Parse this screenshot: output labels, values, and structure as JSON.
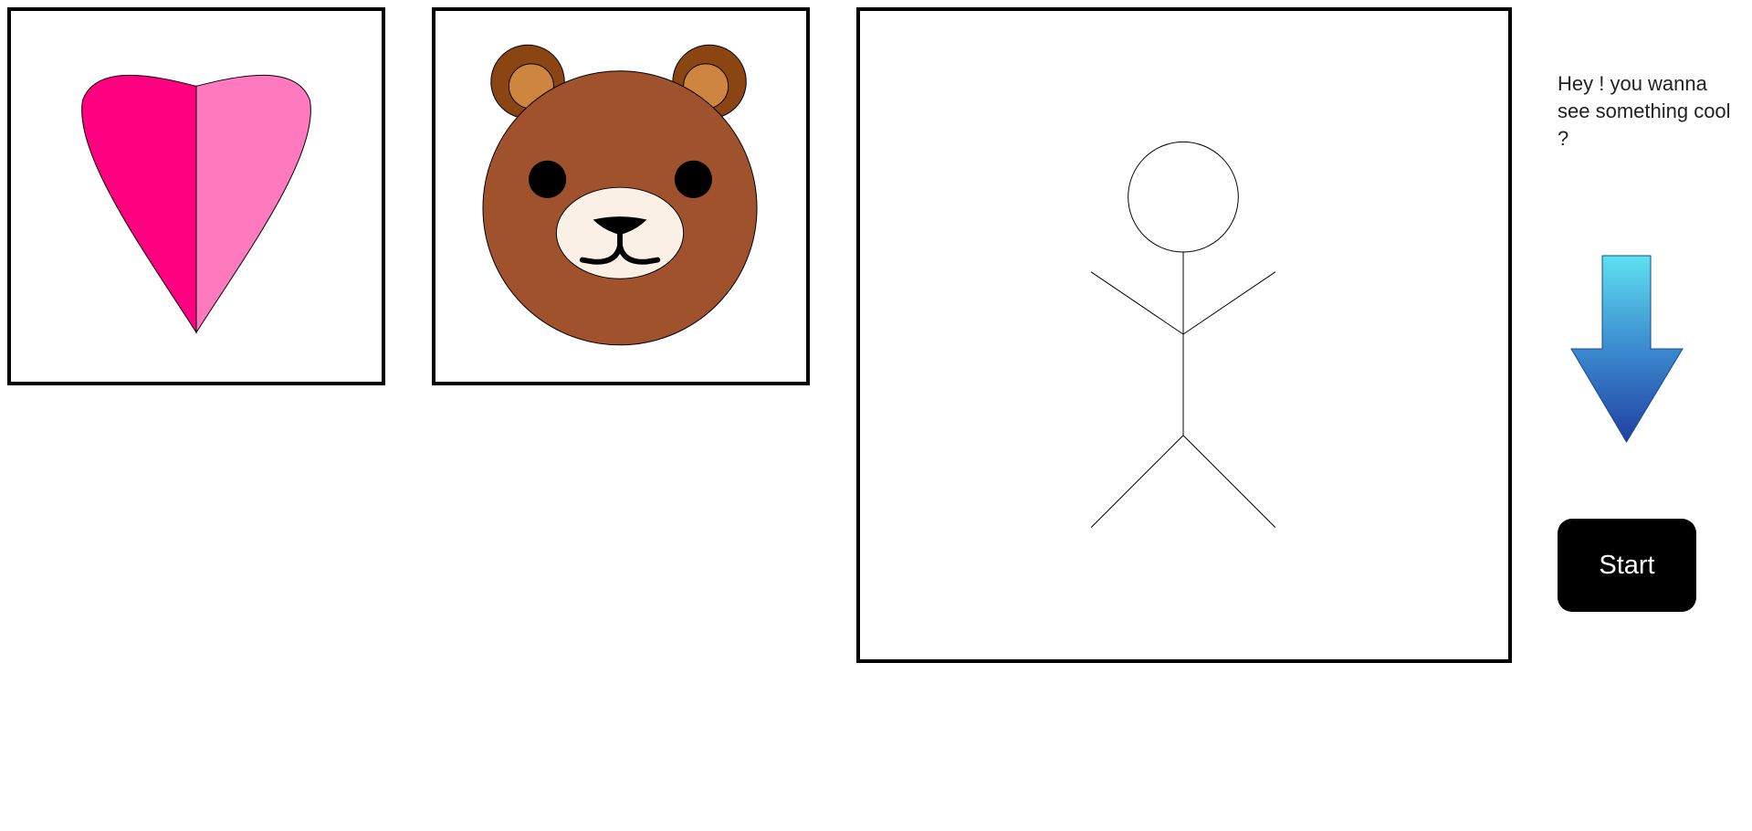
{
  "prompt": {
    "text": "Hey ! you wanna see something cool ?"
  },
  "start_button": {
    "label": "Start"
  },
  "colors": {
    "heart_left": "#ff0080",
    "heart_right": "#ff79bf",
    "bear_face": "#a0522d",
    "bear_ear_outer": "#8b4513",
    "bear_ear_inner": "#cd853f",
    "bear_muzzle": "#faf0e6",
    "arrow_top": "#5ee0f0",
    "arrow_bottom": "#2040a0",
    "button_bg": "#000000",
    "button_text": "#ffffff"
  },
  "icons": [
    "heart-icon",
    "bear-face-icon",
    "stick-figure-icon",
    "arrow-down-icon"
  ]
}
